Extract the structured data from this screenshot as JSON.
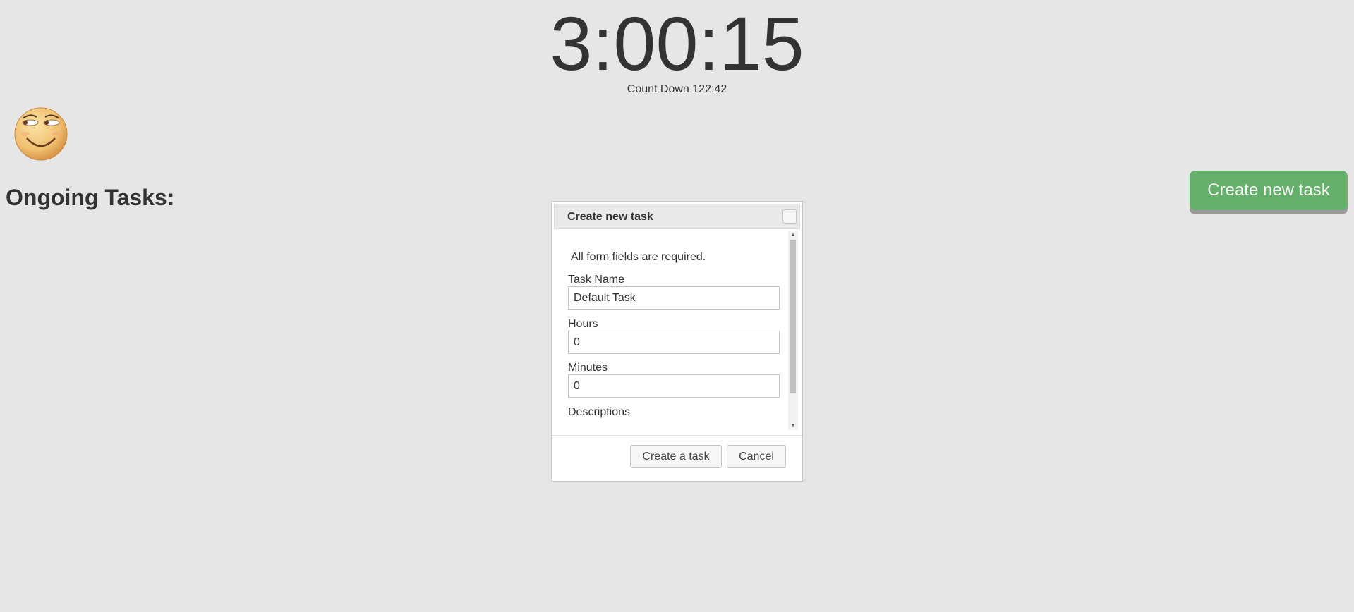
{
  "clock": {
    "time": "3:00:15",
    "countdown": "Count Down 122:42"
  },
  "page": {
    "heading": "Ongoing Tasks:",
    "create_button_label": "Create new task"
  },
  "dialog": {
    "title": "Create new task",
    "note": "All form fields are required.",
    "fields": [
      {
        "label": "Task Name",
        "value": "Default Task"
      },
      {
        "label": "Hours",
        "value": "0"
      },
      {
        "label": "Minutes",
        "value": "0"
      },
      {
        "label": "Descriptions"
      }
    ],
    "buttons": {
      "create": "Create a task",
      "cancel": "Cancel"
    }
  },
  "colors": {
    "background": "#e6e6e6",
    "accent_green": "#64b06a",
    "text": "#333333"
  },
  "icons": {
    "avatar": "smiley-face-icon",
    "close": "close-icon",
    "scroll_up": "triangle-up-icon",
    "scroll_down": "triangle-down-icon"
  }
}
